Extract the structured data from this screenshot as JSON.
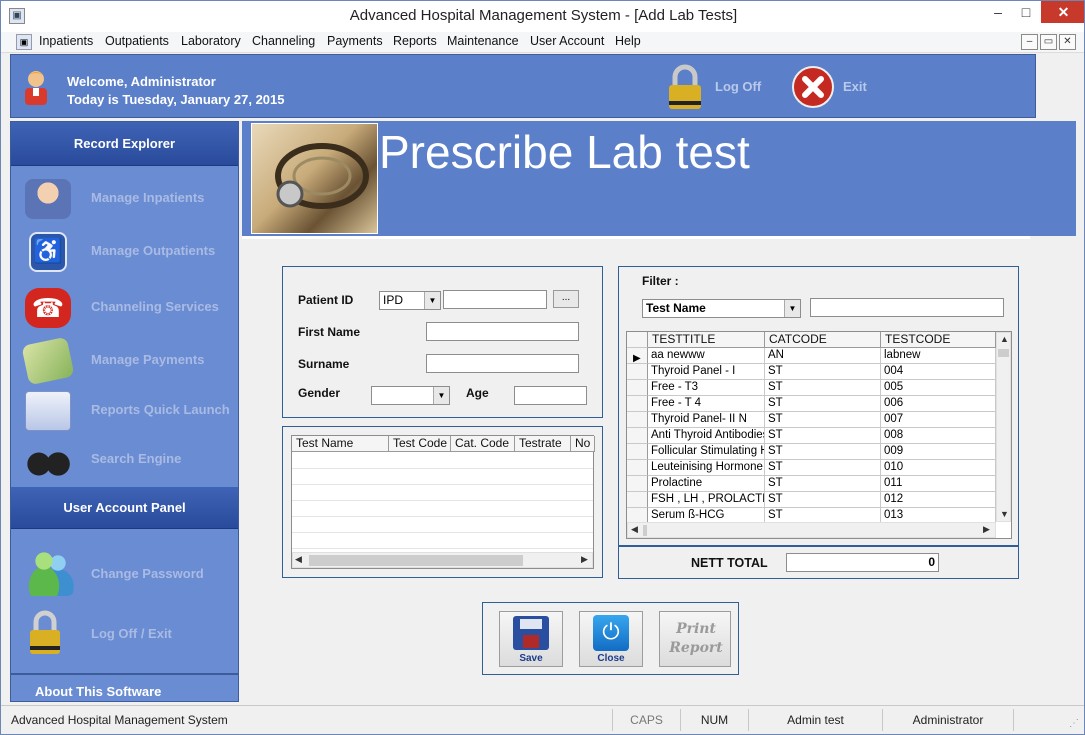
{
  "window": {
    "title": "Advanced Hospital Management System - [Add Lab Tests]",
    "min": "–",
    "max": "□",
    "close": "✕"
  },
  "menu": {
    "items": [
      "Inpatients",
      "Outpatients",
      "Laboratory",
      "Channeling",
      "Payments",
      "Reports",
      "Maintenance",
      "User Account",
      "Help"
    ],
    "mdi": [
      "–",
      "▭",
      "✕"
    ]
  },
  "header": {
    "welcome": "Welcome, Administrator",
    "date": "Today is Tuesday, January 27, 2015",
    "logoff": "Log Off",
    "exit": "Exit"
  },
  "sidebar": {
    "record_title": "Record Explorer",
    "items": [
      {
        "label": "Manage Inpatients",
        "icon": "patient-icon"
      },
      {
        "label": "Manage Outpatients",
        "icon": "wheelchair-icon"
      },
      {
        "label": "Channeling Services",
        "icon": "telephone-icon"
      },
      {
        "label": "Manage Payments",
        "icon": "money-icon"
      },
      {
        "label": "Reports Quick Launch",
        "icon": "folder-icon"
      },
      {
        "label": "Search Engine",
        "icon": "binoculars-icon"
      }
    ],
    "user_title": "User Account Panel",
    "user_items": [
      {
        "label": "Change Password",
        "icon": "users-icon"
      },
      {
        "label": "Log Off / Exit",
        "icon": "padlock-icon"
      }
    ],
    "about": "About This Software"
  },
  "page": {
    "title": "Prescribe Lab test"
  },
  "patient_form": {
    "patient_id_label": "Patient ID",
    "patient_type": "IPD",
    "patient_id_value": "",
    "browse": "...",
    "first_name_label": "First Name",
    "first_name_value": "",
    "surname_label": "Surname",
    "surname_value": "",
    "gender_label": "Gender",
    "gender_value": "",
    "age_label": "Age",
    "age_value": ""
  },
  "selected_grid": {
    "columns": [
      "Test Name",
      "Test Code",
      "Cat. Code",
      "Testrate",
      "No"
    ]
  },
  "filter": {
    "label": "Filter :",
    "field": "Test Name",
    "value": ""
  },
  "tests_grid": {
    "columns": [
      "TESTTITLE",
      "CATCODE",
      "TESTCODE"
    ],
    "rows": [
      [
        "aa newww",
        "AN",
        "labnew"
      ],
      [
        "Thyroid Panel - I",
        "ST",
        "004"
      ],
      [
        "Free - T3",
        "ST",
        "005"
      ],
      [
        "Free - T 4",
        "ST",
        "006"
      ],
      [
        "Thyroid  Panel- II N",
        "ST",
        "007"
      ],
      [
        "Anti Thyroid Antibodies (",
        "ST",
        "008"
      ],
      [
        "Follicular Stimulating Ho",
        "ST",
        "009"
      ],
      [
        "Leuteinising Hormone",
        "ST",
        "010"
      ],
      [
        "Prolactine",
        "ST",
        "011"
      ],
      [
        "FSH , LH , PROLACTIN",
        "ST",
        "012"
      ],
      [
        "Serum ß-HCG",
        "ST",
        "013"
      ]
    ]
  },
  "totals": {
    "label": "NETT TOTAL",
    "value": "0"
  },
  "actions": {
    "save": "Save",
    "close": "Close",
    "print1": "Print",
    "print2": "Report"
  },
  "statusbar": {
    "app": "Advanced Hospital Management System",
    "caps": "CAPS",
    "num": "NUM",
    "user": "Admin test",
    "role": "Administrator"
  }
}
